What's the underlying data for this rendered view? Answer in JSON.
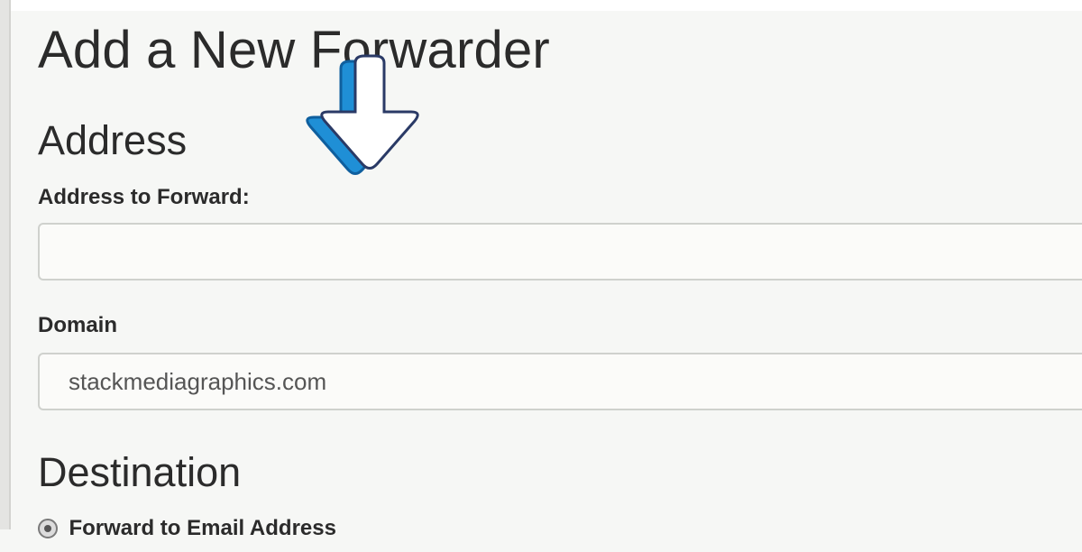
{
  "page": {
    "title": "Add a New Forwarder"
  },
  "address_section": {
    "heading": "Address",
    "address_to_forward": {
      "label": "Address to Forward:",
      "value": "",
      "placeholder": ""
    },
    "domain": {
      "label": "Domain",
      "value": "stackmediagraphics.com"
    }
  },
  "destination_section": {
    "heading": "Destination",
    "options": [
      {
        "label": "Forward to Email Address",
        "selected": true
      }
    ]
  },
  "overlay": {
    "pointer_icon": "down-arrow-icon",
    "colors": {
      "arrow_fill": "#ffffff",
      "arrow_shadow": "#1f8fd6",
      "arrow_outline": "#2a3a66"
    }
  }
}
